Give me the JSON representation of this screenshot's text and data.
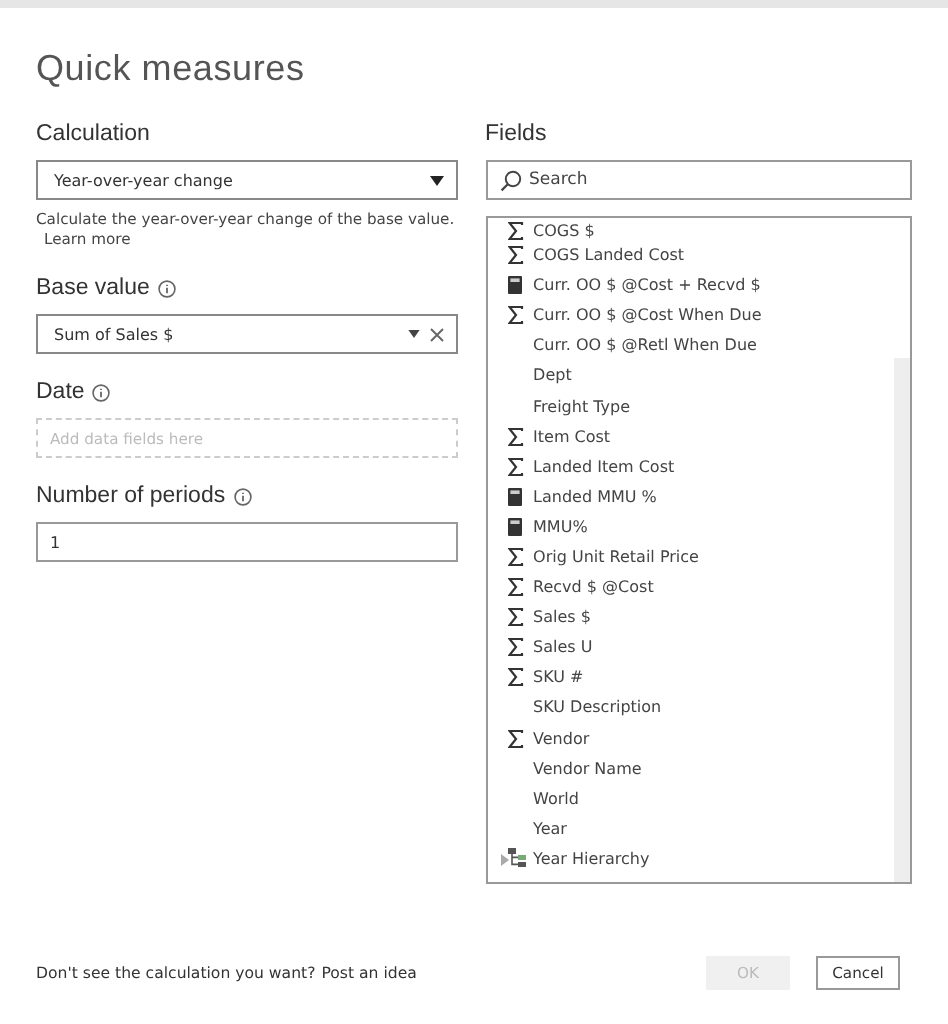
{
  "title": "Quick measures",
  "calculation": {
    "label": "Calculation",
    "value": "Year-over-year change",
    "description": "Calculate the year-over-year change of the base value.",
    "learn_more": "Learn more"
  },
  "base_value": {
    "label": "Base value",
    "value": "Sum of Sales $"
  },
  "date": {
    "label": "Date",
    "placeholder": "Add data fields here"
  },
  "periods": {
    "label": "Number of periods",
    "value": "1"
  },
  "fields": {
    "label": "Fields",
    "search_placeholder": "Search",
    "items": [
      {
        "name": "COGS $",
        "kind": "sigma"
      },
      {
        "name": "COGS Landed Cost",
        "kind": "sigma"
      },
      {
        "name": "Curr. OO $ @Cost + Recvd $",
        "kind": "calc"
      },
      {
        "name": "Curr. OO $ @Cost When Due",
        "kind": "sigma"
      },
      {
        "name": "Curr. OO $ @Retl When Due",
        "kind": "text"
      },
      {
        "name": "Dept",
        "kind": "text"
      },
      {
        "name": "Freight Type",
        "kind": "text"
      },
      {
        "name": "Item Cost",
        "kind": "sigma"
      },
      {
        "name": "Landed Item Cost",
        "kind": "sigma"
      },
      {
        "name": "Landed MMU %",
        "kind": "calc"
      },
      {
        "name": "MMU%",
        "kind": "calc"
      },
      {
        "name": "Orig Unit Retail Price",
        "kind": "sigma"
      },
      {
        "name": "Recvd $ @Cost",
        "kind": "sigma"
      },
      {
        "name": "Sales $",
        "kind": "sigma"
      },
      {
        "name": "Sales U",
        "kind": "sigma"
      },
      {
        "name": "SKU #",
        "kind": "sigma"
      },
      {
        "name": "SKU Description",
        "kind": "text"
      },
      {
        "name": "Vendor",
        "kind": "sigma"
      },
      {
        "name": "Vendor Name",
        "kind": "text"
      },
      {
        "name": "World",
        "kind": "text"
      },
      {
        "name": "Year",
        "kind": "text"
      },
      {
        "name": "Year Hierarchy",
        "kind": "hierarchy",
        "expanded": false
      }
    ]
  },
  "footer": {
    "prompt": "Don't see the calculation you want?",
    "link": "Post an idea"
  },
  "buttons": [
    {
      "label": "OK",
      "disabled": true
    },
    {
      "label": "Cancel",
      "disabled": false
    }
  ]
}
